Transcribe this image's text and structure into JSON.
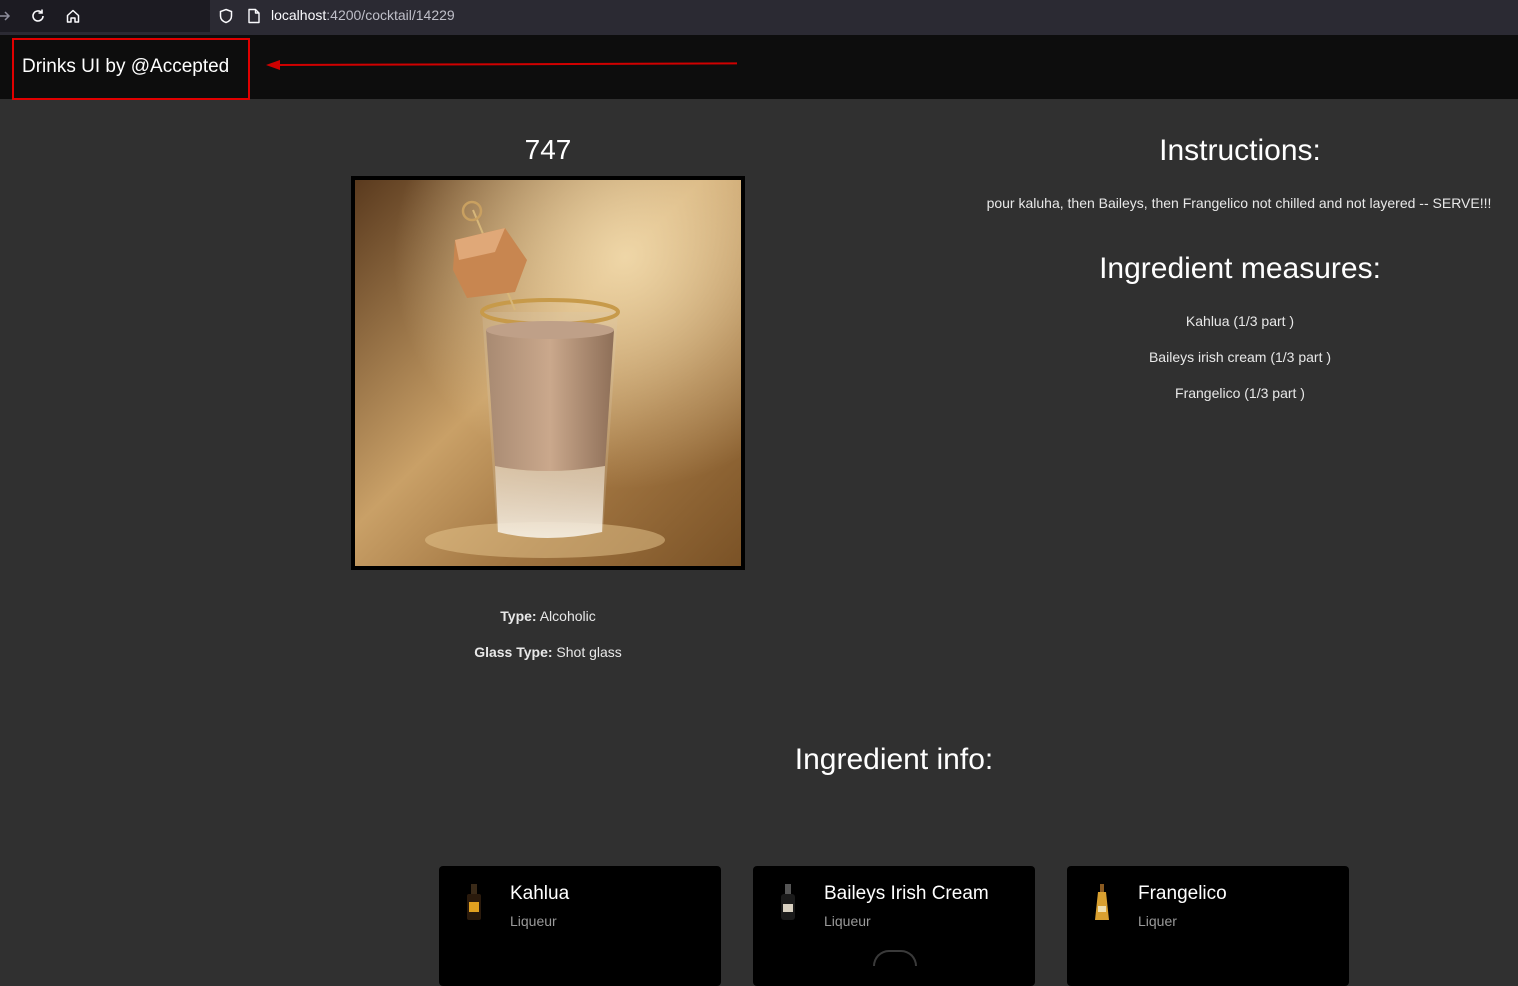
{
  "browser": {
    "url_host": "localhost",
    "url_path": ":4200/cocktail/14229"
  },
  "header": {
    "brand": "Drinks UI by @Accepted"
  },
  "drink": {
    "name": "747",
    "type_label": "Type:",
    "type_value": "Alcoholic",
    "glass_label": "Glass Type:",
    "glass_value": "Shot glass"
  },
  "instructions": {
    "title": "Instructions:",
    "text": "pour kaluha, then Baileys, then Frangelico not chilled and not layered -- SERVE!!!"
  },
  "measures": {
    "title": "Ingredient measures:",
    "items": [
      "Kahlua (1/3 part )",
      "Baileys irish cream (1/3 part )",
      "Frangelico (1/3 part )"
    ]
  },
  "ingredient_info": {
    "title": "Ingredient info:",
    "cards": [
      {
        "name": "Kahlua",
        "type": "Liqueur",
        "icon": "kahlua-bottle-icon"
      },
      {
        "name": "Baileys Irish Cream",
        "type": "Liqueur",
        "icon": "baileys-bottle-icon"
      },
      {
        "name": "Frangelico",
        "type": "Liquer",
        "icon": "frangelico-bottle-icon"
      }
    ]
  },
  "annotation": {
    "highlight_color": "#e00000"
  }
}
